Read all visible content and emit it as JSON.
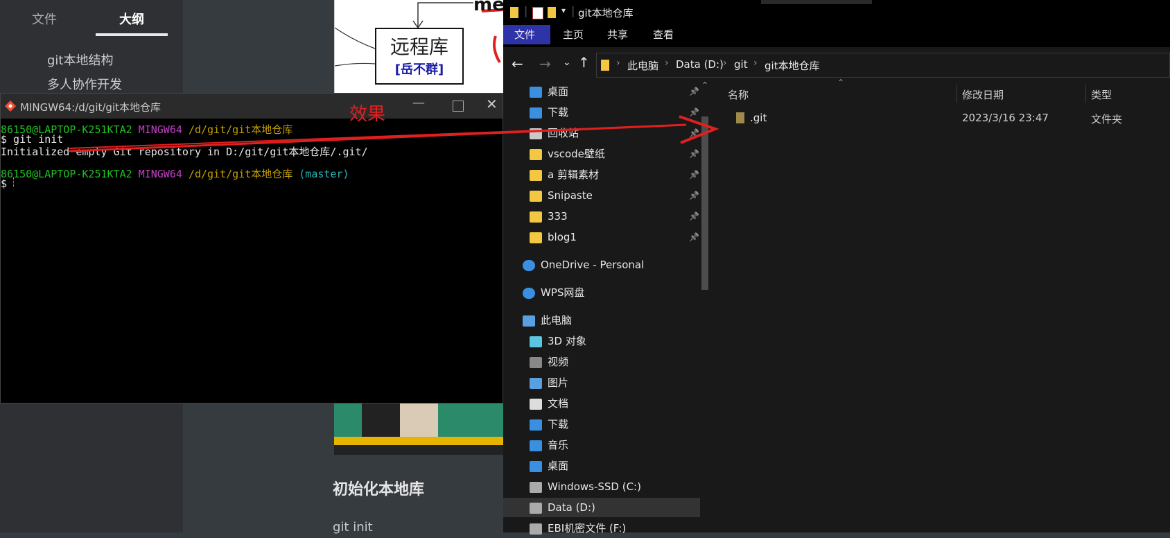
{
  "outline": {
    "tabs": [
      "文件",
      "大纲"
    ],
    "items": [
      "git本地结构",
      "多人协作开发"
    ]
  },
  "diagram": {
    "top_text": "me",
    "box_title": "远程库",
    "box_sub": "[岳不群]"
  },
  "annotation": {
    "label": "效果"
  },
  "terminal": {
    "title": "MINGW64:/d/git/git本地仓库",
    "lines": [
      {
        "user": "86150@LAPTOP-K251KTA2",
        "shell": "MINGW64",
        "path": "/d/git/git本地仓库",
        "branch": ""
      },
      {
        "cmd": "$ git init"
      },
      {
        "out": "Initialized empty Git repository in D:/git/git本地仓库/.git/"
      },
      {
        "user": "86150@LAPTOP-K251KTA2",
        "shell": "MINGW64",
        "path": "/d/git/git本地仓库",
        "branch": "(master)"
      },
      {
        "cmd": "$ "
      }
    ]
  },
  "editor": {
    "heading": "初始化本地库",
    "code": "git init"
  },
  "explorer": {
    "title": "git本地仓库",
    "ribbon": [
      "文件",
      "主页",
      "共享",
      "查看"
    ],
    "breadcrumb": [
      "此电脑",
      "Data (D:)",
      "git",
      "git本地仓库"
    ],
    "nav_items": [
      {
        "label": "桌面",
        "icon": "desktop-icon",
        "pinned": true
      },
      {
        "label": "下载",
        "icon": "download-icon",
        "pinned": true
      },
      {
        "label": "回收站",
        "icon": "recycle-bin-icon",
        "pinned": true
      },
      {
        "label": "vscode壁纸",
        "icon": "folder-icon",
        "pinned": true
      },
      {
        "label": "a 剪辑素材",
        "icon": "folder-icon",
        "pinned": true
      },
      {
        "label": "Snipaste",
        "icon": "folder-icon",
        "pinned": true
      },
      {
        "label": "333",
        "icon": "folder-icon",
        "pinned": true
      },
      {
        "label": "blog1",
        "icon": "folder-icon",
        "pinned": true
      },
      {
        "label": "OneDrive - Personal",
        "icon": "cloud-icon",
        "pinned": false
      },
      {
        "label": "WPS网盘",
        "icon": "cloud-icon",
        "pinned": false
      },
      {
        "label": "此电脑",
        "icon": "computer-icon",
        "pinned": false
      },
      {
        "label": "3D 对象",
        "icon": "cube-icon",
        "pinned": false
      },
      {
        "label": "视频",
        "icon": "video-icon",
        "pinned": false
      },
      {
        "label": "图片",
        "icon": "picture-icon",
        "pinned": false
      },
      {
        "label": "文档",
        "icon": "document-icon",
        "pinned": false
      },
      {
        "label": "下载",
        "icon": "download-icon",
        "pinned": false
      },
      {
        "label": "音乐",
        "icon": "music-icon",
        "pinned": false
      },
      {
        "label": "桌面",
        "icon": "desktop-icon",
        "pinned": false
      },
      {
        "label": "Windows-SSD (C:)",
        "icon": "drive-icon",
        "pinned": false
      },
      {
        "label": "Data (D:)",
        "icon": "drive-icon",
        "pinned": false,
        "selected": true
      },
      {
        "label": "EBI机密文件 (F:)",
        "icon": "drive-icon",
        "pinned": false
      }
    ],
    "columns": [
      "名称",
      "修改日期",
      "类型"
    ],
    "files": [
      {
        "name": ".git",
        "date": "2023/3/16 23:47",
        "type": "文件夹"
      }
    ]
  },
  "colors": {
    "term_user": "#21c021",
    "term_shell": "#c440c4",
    "term_path": "#c4a000",
    "term_branch": "#2bb5b5",
    "arrow": "#e02020",
    "ribbon_active": "#2e33a8"
  }
}
